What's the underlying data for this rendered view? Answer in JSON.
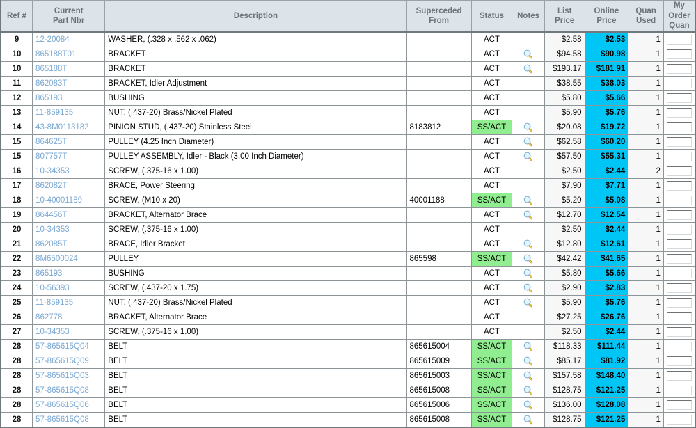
{
  "colors": {
    "header_bg": "#dde4e9",
    "header_text": "#6b7478",
    "online_price_bg": "#00c6f5",
    "status_ss_bg": "#90ee90",
    "list_price_bg": "#f7f7f7",
    "part_link": "#7ba9d4",
    "border": "#8d9599"
  },
  "table": {
    "columns": [
      {
        "key": "ref",
        "label": "Ref #"
      },
      {
        "key": "part",
        "label": "Current\nPart Nbr"
      },
      {
        "key": "desc",
        "label": "Description"
      },
      {
        "key": "sup",
        "label": "Superceded\nFrom"
      },
      {
        "key": "status",
        "label": "Status"
      },
      {
        "key": "notes",
        "label": "Notes"
      },
      {
        "key": "list",
        "label": "List\nPrice"
      },
      {
        "key": "online",
        "label": "Online\nPrice"
      },
      {
        "key": "quan",
        "label": "Quan\nUsed"
      },
      {
        "key": "order",
        "label": "My\nOrder\nQuan"
      }
    ],
    "note_icon": "magnifier-icon",
    "rows": [
      {
        "ref": "9",
        "part": "12-20084",
        "desc": "WASHER, (.328 x .562 x .062)",
        "sup": "",
        "status": "ACT",
        "notes": false,
        "list": "$2.58",
        "online": "$2.53",
        "quan": "1",
        "order": ""
      },
      {
        "ref": "10",
        "part": "865188T01",
        "desc": "BRACKET",
        "sup": "",
        "status": "ACT",
        "notes": true,
        "list": "$94.58",
        "online": "$90.98",
        "quan": "1",
        "order": ""
      },
      {
        "ref": "10",
        "part": "865188T",
        "desc": "BRACKET",
        "sup": "",
        "status": "ACT",
        "notes": true,
        "list": "$193.17",
        "online": "$181.91",
        "quan": "1",
        "order": ""
      },
      {
        "ref": "11",
        "part": "862083T",
        "desc": "BRACKET, Idler Adjustment",
        "sup": "",
        "status": "ACT",
        "notes": false,
        "list": "$38.55",
        "online": "$38.03",
        "quan": "1",
        "order": ""
      },
      {
        "ref": "12",
        "part": "865193",
        "desc": "BUSHING",
        "sup": "",
        "status": "ACT",
        "notes": false,
        "list": "$5.80",
        "online": "$5.66",
        "quan": "1",
        "order": ""
      },
      {
        "ref": "13",
        "part": "11-859135",
        "desc": "NUT, (.437-20) Brass/Nickel Plated",
        "sup": "",
        "status": "ACT",
        "notes": false,
        "list": "$5.90",
        "online": "$5.76",
        "quan": "1",
        "order": ""
      },
      {
        "ref": "14",
        "part": "43-8M0113182",
        "desc": "PINION STUD, (.437-20) Stainless Steel",
        "sup": "8183812",
        "status": "SS/ACT",
        "notes": true,
        "list": "$20.08",
        "online": "$19.72",
        "quan": "1",
        "order": ""
      },
      {
        "ref": "15",
        "part": "864625T",
        "desc": "PULLEY (4.25 Inch Diameter)",
        "sup": "",
        "status": "ACT",
        "notes": true,
        "list": "$62.58",
        "online": "$60.20",
        "quan": "1",
        "order": ""
      },
      {
        "ref": "15",
        "part": "807757T",
        "desc": "PULLEY ASSEMBLY, Idler - Black (3.00 Inch Diameter)",
        "sup": "",
        "status": "ACT",
        "notes": true,
        "list": "$57.50",
        "online": "$55.31",
        "quan": "1",
        "order": ""
      },
      {
        "ref": "16",
        "part": "10-34353",
        "desc": "SCREW, (.375-16 x 1.00)",
        "sup": "",
        "status": "ACT",
        "notes": false,
        "list": "$2.50",
        "online": "$2.44",
        "quan": "2",
        "order": ""
      },
      {
        "ref": "17",
        "part": "862082T",
        "desc": "BRACE, Power Steering",
        "sup": "",
        "status": "ACT",
        "notes": false,
        "list": "$7.90",
        "online": "$7.71",
        "quan": "1",
        "order": ""
      },
      {
        "ref": "18",
        "part": "10-40001189",
        "desc": "SCREW, (M10 x 20)",
        "sup": "40001188",
        "status": "SS/ACT",
        "notes": true,
        "list": "$5.20",
        "online": "$5.08",
        "quan": "1",
        "order": ""
      },
      {
        "ref": "19",
        "part": "864456T",
        "desc": "BRACKET, Alternator Brace",
        "sup": "",
        "status": "ACT",
        "notes": true,
        "list": "$12.70",
        "online": "$12.54",
        "quan": "1",
        "order": ""
      },
      {
        "ref": "20",
        "part": "10-34353",
        "desc": "SCREW, (.375-16 x 1.00)",
        "sup": "",
        "status": "ACT",
        "notes": false,
        "list": "$2.50",
        "online": "$2.44",
        "quan": "1",
        "order": ""
      },
      {
        "ref": "21",
        "part": "862085T",
        "desc": "BRACE, Idler Bracket",
        "sup": "",
        "status": "ACT",
        "notes": true,
        "list": "$12.80",
        "online": "$12.61",
        "quan": "1",
        "order": ""
      },
      {
        "ref": "22",
        "part": "8M6500024",
        "desc": "PULLEY",
        "sup": "865598",
        "status": "SS/ACT",
        "notes": true,
        "list": "$42.42",
        "online": "$41.65",
        "quan": "1",
        "order": ""
      },
      {
        "ref": "23",
        "part": "865193",
        "desc": "BUSHING",
        "sup": "",
        "status": "ACT",
        "notes": true,
        "list": "$5.80",
        "online": "$5.66",
        "quan": "1",
        "order": ""
      },
      {
        "ref": "24",
        "part": "10-56393",
        "desc": "SCREW, (.437-20 x 1.75)",
        "sup": "",
        "status": "ACT",
        "notes": true,
        "list": "$2.90",
        "online": "$2.83",
        "quan": "1",
        "order": ""
      },
      {
        "ref": "25",
        "part": "11-859135",
        "desc": "NUT, (.437-20) Brass/Nickel Plated",
        "sup": "",
        "status": "ACT",
        "notes": true,
        "list": "$5.90",
        "online": "$5.76",
        "quan": "1",
        "order": ""
      },
      {
        "ref": "26",
        "part": "862778",
        "desc": "BRACKET, Alternator Brace",
        "sup": "",
        "status": "ACT",
        "notes": false,
        "list": "$27.25",
        "online": "$26.76",
        "quan": "1",
        "order": ""
      },
      {
        "ref": "27",
        "part": "10-34353",
        "desc": "SCREW, (.375-16 x 1.00)",
        "sup": "",
        "status": "ACT",
        "notes": false,
        "list": "$2.50",
        "online": "$2.44",
        "quan": "1",
        "order": ""
      },
      {
        "ref": "28",
        "part": "57-865615Q04",
        "desc": "BELT",
        "sup": "865615004",
        "status": "SS/ACT",
        "notes": true,
        "list": "$118.33",
        "online": "$111.44",
        "quan": "1",
        "order": ""
      },
      {
        "ref": "28",
        "part": "57-865615Q09",
        "desc": "BELT",
        "sup": "865615009",
        "status": "SS/ACT",
        "notes": true,
        "list": "$85.17",
        "online": "$81.92",
        "quan": "1",
        "order": ""
      },
      {
        "ref": "28",
        "part": "57-865615Q03",
        "desc": "BELT",
        "sup": "865615003",
        "status": "SS/ACT",
        "notes": true,
        "list": "$157.58",
        "online": "$148.40",
        "quan": "1",
        "order": ""
      },
      {
        "ref": "28",
        "part": "57-865615Q08",
        "desc": "BELT",
        "sup": "865615008",
        "status": "SS/ACT",
        "notes": true,
        "list": "$128.75",
        "online": "$121.25",
        "quan": "1",
        "order": ""
      },
      {
        "ref": "28",
        "part": "57-865615Q06",
        "desc": "BELT",
        "sup": "865615006",
        "status": "SS/ACT",
        "notes": true,
        "list": "$136.00",
        "online": "$128.08",
        "quan": "1",
        "order": ""
      },
      {
        "ref": "28",
        "part": "57-865615Q08",
        "desc": "BELT",
        "sup": "865615008",
        "status": "SS/ACT",
        "notes": true,
        "list": "$128.75",
        "online": "$121.25",
        "quan": "1",
        "order": ""
      }
    ]
  }
}
